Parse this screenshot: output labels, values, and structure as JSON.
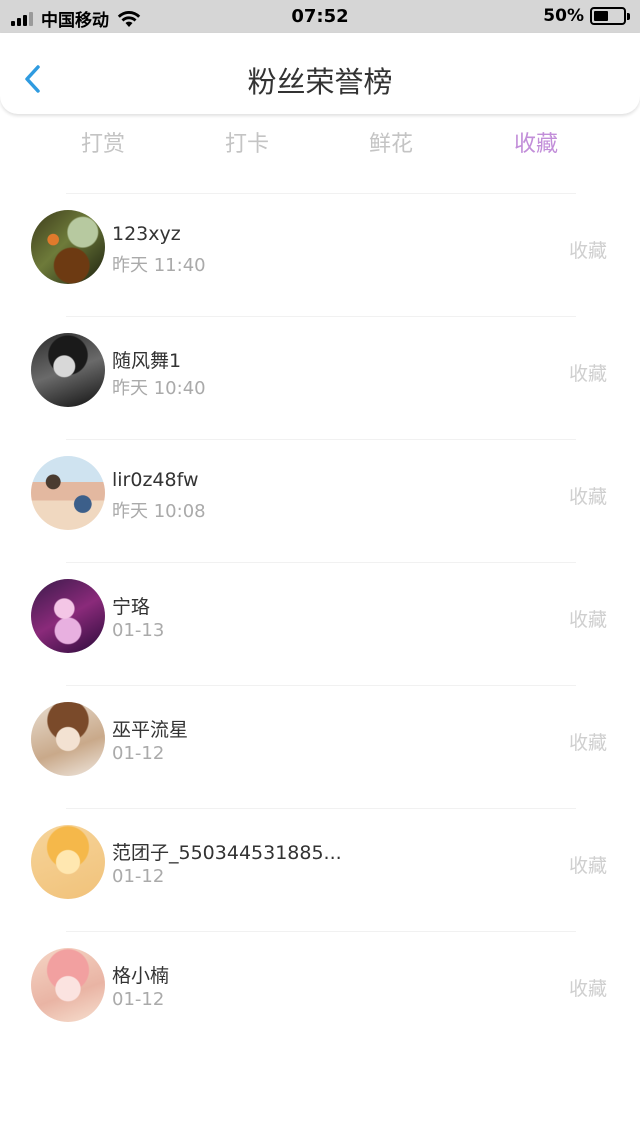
{
  "status_bar": {
    "carrier": "中国移动",
    "time": "07:52",
    "battery": "50%",
    "battery_level": 0.5
  },
  "header": {
    "title": "粉丝荣誉榜",
    "back_icon": "chevron-left-icon",
    "accent_color": "#2f9be0"
  },
  "tabs": [
    {
      "label": "打赏",
      "active": false
    },
    {
      "label": "打卡",
      "active": false
    },
    {
      "label": "鲜花",
      "active": false
    },
    {
      "label": "收藏",
      "active": true
    }
  ],
  "active_tab_color": "#c28ed9",
  "fans": [
    {
      "name": "123xyz",
      "time": "昨天 11:40",
      "action": "收藏",
      "avatar": "photo-avatar"
    },
    {
      "name": "随风舞1",
      "time": "昨天 10:40",
      "action": "收藏",
      "avatar": "bw-portrait-avatar"
    },
    {
      "name": "lir0z48fw",
      "time": "昨天 10:08",
      "action": "收藏",
      "avatar": "family-photo-avatar"
    },
    {
      "name": "宁珞",
      "time": "01-13",
      "action": "收藏",
      "avatar": "anime-girl-avatar"
    },
    {
      "name": "巫平流星",
      "time": "01-12",
      "action": "收藏",
      "avatar": "anime-girl-avatar"
    },
    {
      "name": "范团子_550344531885...",
      "time": "01-12",
      "action": "收藏",
      "avatar": "cartoon-avatar"
    },
    {
      "name": "格小楠",
      "time": "01-12",
      "action": "收藏",
      "avatar": "anime-girl-avatar"
    }
  ]
}
